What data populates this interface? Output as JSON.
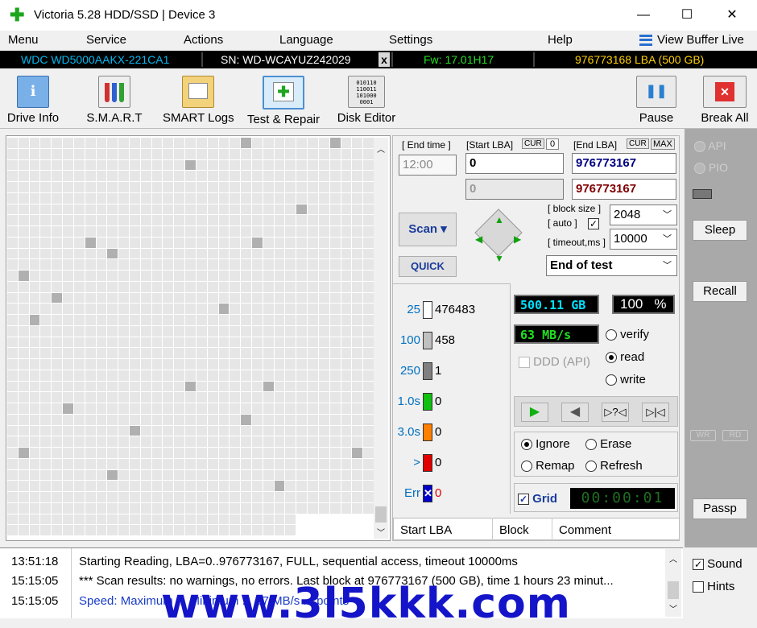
{
  "window": {
    "title": "Victoria 5.28 HDD/SSD | Device 3",
    "min": "—",
    "max": "☐",
    "close": "✕"
  },
  "menu": [
    "Menu",
    "Service",
    "Actions",
    "Language",
    "Settings",
    "Help"
  ],
  "view_buffer": "View Buffer Live",
  "infobar": {
    "model": "WDC WD5000AAKX-221CA1",
    "serial": "SN: WD-WCAYUZ242029",
    "close": "x",
    "firmware": "Fw: 17.01H17",
    "lba": "976773168 LBA (500 GB)"
  },
  "toolbar": {
    "drive_info": "Drive Info",
    "smart": "S.M.A.R.T",
    "smart_logs": "SMART Logs",
    "test_repair": "Test & Repair",
    "disk_editor": "Disk Editor",
    "pause": "Pause",
    "break_all": "Break All",
    "disk_editor_bits": [
      "010110",
      "110011",
      "101000",
      "0001"
    ]
  },
  "controls": {
    "end_time_label": "[ End time ]",
    "end_time": "12:00",
    "start_lba_label": "[Start LBA]",
    "cur": "CUR",
    "cur_value": "0",
    "end_lba_label": "[End LBA]",
    "max": "MAX",
    "start_lba": "0",
    "end_lba": "976773167",
    "start_lba_2": "0",
    "end_lba_2": "976773167",
    "scan": "Scan",
    "quick": "QUICK",
    "block_size_label": "[ block size ]",
    "auto_label": "[ auto ]",
    "block_size": "2048",
    "timeout_label": "[ timeout,ms ]",
    "timeout": "10000",
    "end_of_test": "End of test"
  },
  "stats": [
    {
      "label": "25",
      "count": "476483",
      "color": "#ffffff"
    },
    {
      "label": "100",
      "count": "458",
      "color": "#c0c0c0"
    },
    {
      "label": "250",
      "count": "1",
      "color": "#808080"
    },
    {
      "label": "1.0s",
      "count": "0",
      "color": "#10c010"
    },
    {
      "label": "3.0s",
      "count": "0",
      "color": "#ff8000"
    },
    {
      "label": ">",
      "count": "0",
      "color": "#e00000"
    },
    {
      "label": "Err",
      "count": "0",
      "color": "#0000c8"
    }
  ],
  "readout": {
    "size": "500.11 GB",
    "percent": "100",
    "pct_sign": "%",
    "speed": "63 MB/s",
    "ddd": "DDD (API)"
  },
  "mode": {
    "verify": "verify",
    "read": "read",
    "write": "write"
  },
  "repair": {
    "ignore": "Ignore",
    "erase": "Erase",
    "remap": "Remap",
    "refresh": "Refresh"
  },
  "grid_label": "Grid",
  "timer": "00:00:01",
  "table_headers": [
    "Start LBA",
    "Block",
    "Comment"
  ],
  "right": {
    "api": "API",
    "pio": "PIO",
    "sleep": "Sleep",
    "recall": "Recall",
    "wr": "WR",
    "rd": "RD",
    "passp": "Passp",
    "sound": "Sound",
    "hints": "Hints"
  },
  "log": [
    {
      "time": "13:51:18",
      "msg": "Starting Reading, LBA=0..976773167, FULL, sequential access, timeout 10000ms",
      "color": "#000000"
    },
    {
      "time": "15:15:05",
      "msg": "*** Scan results: no warnings, no errors. Last block at 976773167 (500 GB), time 1 hours 23 minut...",
      "color": "#000000"
    },
    {
      "time": "15:15:05",
      "msg": "Speed: Maximum ... Minimum ... 97 MB/s ... points",
      "color": "#1a3cc8"
    }
  ],
  "watermark": "www.3l5kkk.com",
  "colors": {
    "accent_cyan": "#00c0ff",
    "accent_yellow": "#ffd000",
    "lcd_green": "#20e020",
    "lcd_cyan": "#00e0ff"
  }
}
